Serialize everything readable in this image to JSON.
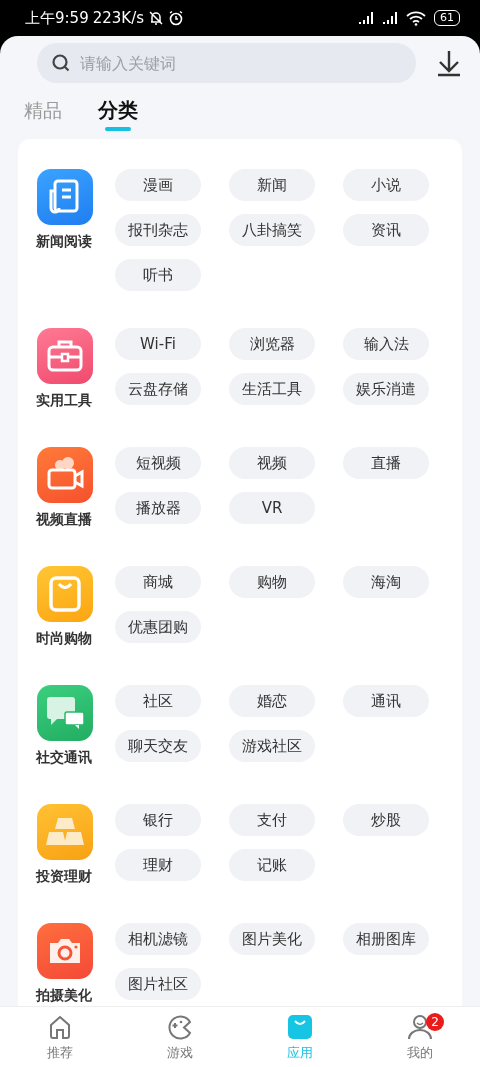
{
  "status_bar": {
    "time": "上午9:59",
    "speed": "223K/s",
    "battery": "61"
  },
  "search": {
    "placeholder": "请输入关键词"
  },
  "tabs": [
    {
      "label": "精品",
      "selected": false
    },
    {
      "label": "分类",
      "selected": true
    }
  ],
  "categories": [
    {
      "name": "新闻阅读",
      "tags": [
        "漫画",
        "新闻",
        "小说",
        "报刊杂志",
        "八卦搞笑",
        "资讯",
        "听书"
      ]
    },
    {
      "name": "实用工具",
      "tags": [
        "Wi-Fi",
        "浏览器",
        "输入法",
        "云盘存储",
        "生活工具",
        "娱乐消遣"
      ]
    },
    {
      "name": "视频直播",
      "tags": [
        "短视频",
        "视频",
        "直播",
        "播放器",
        "VR"
      ]
    },
    {
      "name": "时尚购物",
      "tags": [
        "商城",
        "购物",
        "海淘",
        "优惠团购"
      ]
    },
    {
      "name": "社交通讯",
      "tags": [
        "社区",
        "婚恋",
        "通讯",
        "聊天交友",
        "游戏社区"
      ]
    },
    {
      "name": "投资理财",
      "tags": [
        "银行",
        "支付",
        "炒股",
        "理财",
        "记账"
      ]
    },
    {
      "name": "拍摄美化",
      "tags": [
        "相机滤镜",
        "图片美化",
        "相册图库",
        "图片社区"
      ]
    }
  ],
  "bottom_nav": [
    {
      "label": "推荐",
      "selected": false
    },
    {
      "label": "游戏",
      "selected": false
    },
    {
      "label": "应用",
      "selected": true
    },
    {
      "label": "我的",
      "selected": false,
      "badge": "2"
    }
  ]
}
